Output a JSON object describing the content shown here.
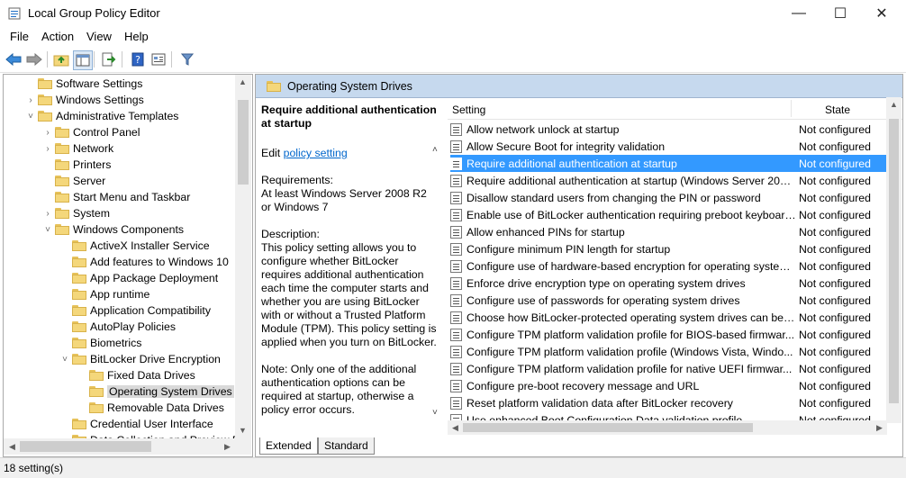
{
  "window": {
    "title": "Local Group Policy Editor",
    "minimize": "—",
    "maximize": "☐",
    "close": "✕"
  },
  "menu": [
    "File",
    "Action",
    "View",
    "Help"
  ],
  "tree": [
    {
      "label": "Software Settings",
      "exp": ""
    },
    {
      "label": "Windows Settings",
      "exp": "›"
    },
    {
      "label": "Administrative Templates",
      "exp": "˅"
    },
    {
      "label": "Control Panel",
      "exp": "›"
    },
    {
      "label": "Network",
      "exp": "›"
    },
    {
      "label": "Printers",
      "exp": ""
    },
    {
      "label": "Server",
      "exp": ""
    },
    {
      "label": "Start Menu and Taskbar",
      "exp": ""
    },
    {
      "label": "System",
      "exp": "›"
    },
    {
      "label": "Windows Components",
      "exp": "˅"
    },
    {
      "label": "ActiveX Installer Service",
      "exp": ""
    },
    {
      "label": "Add features to Windows 10",
      "exp": ""
    },
    {
      "label": "App Package Deployment",
      "exp": ""
    },
    {
      "label": "App runtime",
      "exp": ""
    },
    {
      "label": "Application Compatibility",
      "exp": ""
    },
    {
      "label": "AutoPlay Policies",
      "exp": ""
    },
    {
      "label": "Biometrics",
      "exp": ""
    },
    {
      "label": "BitLocker Drive Encryption",
      "exp": "˅"
    },
    {
      "label": "Fixed Data Drives",
      "exp": ""
    },
    {
      "label": "Operating System Drives",
      "exp": "",
      "selected": true
    },
    {
      "label": "Removable Data Drives",
      "exp": ""
    },
    {
      "label": "Credential User Interface",
      "exp": ""
    },
    {
      "label": "Data Collection and Preview B",
      "exp": ""
    }
  ],
  "header": {
    "title": "Operating System Drives"
  },
  "description": {
    "title": "Require additional authentication at startup",
    "edit_prefix": "Edit ",
    "edit_link": "policy setting",
    "req_label": "Requirements:",
    "req_text": "At least Windows Server 2008 R2 or Windows 7",
    "desc_label": "Description:",
    "desc_text": "This policy setting allows you to configure whether BitLocker requires additional authentication each time the computer starts and whether you are using BitLocker with or without a Trusted Platform Module (TPM). This policy setting is applied when you turn on BitLocker.",
    "note_text": "Note: Only one of the additional authentication options can be required at startup, otherwise a policy error occurs."
  },
  "list": {
    "col_setting": "Setting",
    "col_state": "State",
    "rows": [
      {
        "name": "Allow network unlock at startup",
        "state": "Not configured"
      },
      {
        "name": "Allow Secure Boot for integrity validation",
        "state": "Not configured"
      },
      {
        "name": "Require additional authentication at startup",
        "state": "Not configured",
        "selected": true
      },
      {
        "name": "Require additional authentication at startup (Windows Server 2008 ...",
        "state": "Not configured"
      },
      {
        "name": "Disallow standard users from changing the PIN or password",
        "state": "Not configured"
      },
      {
        "name": "Enable use of BitLocker authentication requiring preboot keyboard...",
        "state": "Not configured"
      },
      {
        "name": "Allow enhanced PINs for startup",
        "state": "Not configured"
      },
      {
        "name": "Configure minimum PIN length for startup",
        "state": "Not configured"
      },
      {
        "name": "Configure use of hardware-based encryption for operating system...",
        "state": "Not configured"
      },
      {
        "name": "Enforce drive encryption type on operating system drives",
        "state": "Not configured"
      },
      {
        "name": "Configure use of passwords for operating system drives",
        "state": "Not configured"
      },
      {
        "name": "Choose how BitLocker-protected operating system drives can be r...",
        "state": "Not configured"
      },
      {
        "name": "Configure TPM platform validation profile for BIOS-based firmwar...",
        "state": "Not configured"
      },
      {
        "name": "Configure TPM platform validation profile (Windows Vista, Windo...",
        "state": "Not configured"
      },
      {
        "name": "Configure TPM platform validation profile for native UEFI firmwar...",
        "state": "Not configured"
      },
      {
        "name": "Configure pre-boot recovery message and URL",
        "state": "Not configured"
      },
      {
        "name": "Reset platform validation data after BitLocker recovery",
        "state": "Not configured"
      },
      {
        "name": "Use enhanced Boot Configuration Data validation profile",
        "state": "Not configured"
      }
    ]
  },
  "tabs": {
    "extended": "Extended",
    "standard": "Standard"
  },
  "status": {
    "text": "18 setting(s)"
  }
}
